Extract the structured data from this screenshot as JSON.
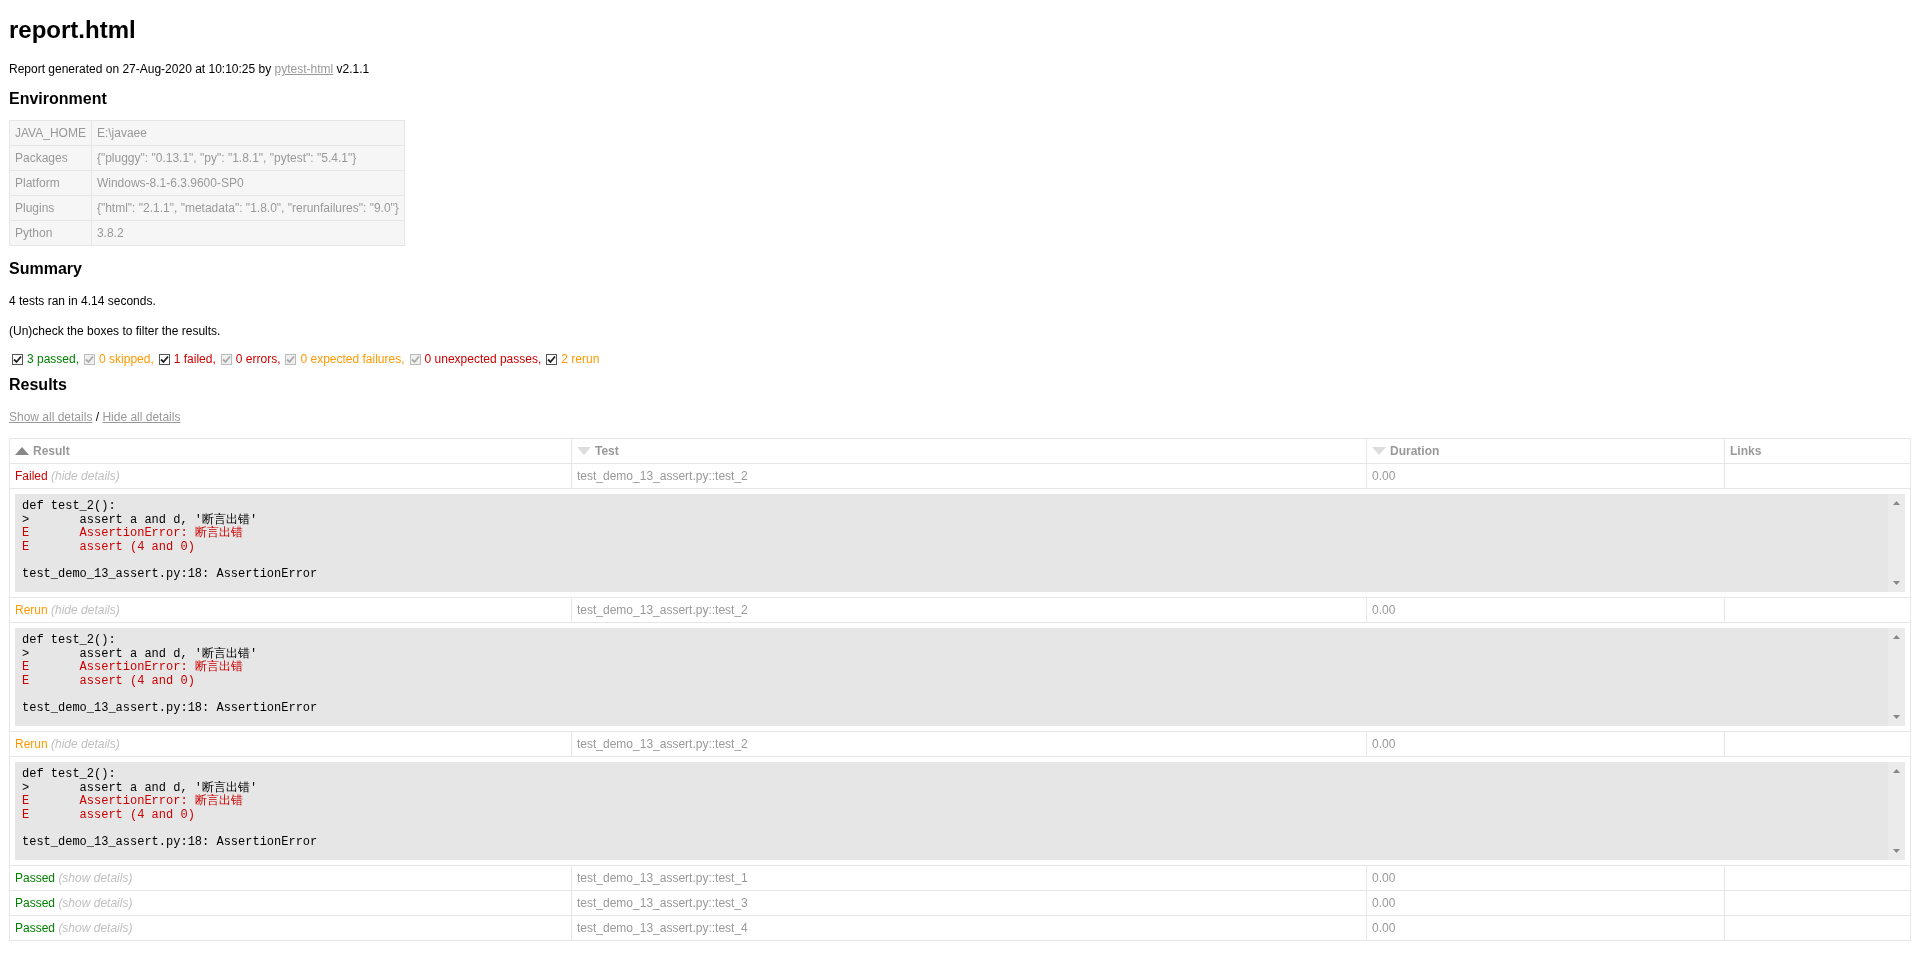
{
  "title": "report.html",
  "generated": {
    "prefix": "Report generated on 27-Aug-2020 at 10:10:25 by",
    "link": "pytest-html",
    "suffix": "v2.1.1"
  },
  "environment": {
    "heading": "Environment",
    "rows": [
      {
        "key": "JAVA_HOME",
        "value": "E:\\javaee"
      },
      {
        "key": "Packages",
        "value": "{\"pluggy\": \"0.13.1\", \"py\": \"1.8.1\", \"pytest\": \"5.4.1\"}"
      },
      {
        "key": "Platform",
        "value": "Windows-8.1-6.3.9600-SP0"
      },
      {
        "key": "Plugins",
        "value": "{\"html\": \"2.1.1\", \"metadata\": \"1.8.0\", \"rerunfailures\": \"9.0\"}"
      },
      {
        "key": "Python",
        "value": "3.8.2"
      }
    ]
  },
  "summary": {
    "heading": "Summary",
    "ran": "4 tests ran in 4.14 seconds.",
    "hint": "(Un)check the boxes to filter the results.",
    "filters": [
      {
        "label": "3 passed,",
        "color": "#008000",
        "checked": true,
        "disabled": false
      },
      {
        "label": "0 skipped,",
        "color": "#ff9900",
        "checked": true,
        "disabled": true
      },
      {
        "label": "1 failed,",
        "color": "#cc0000",
        "checked": true,
        "disabled": false
      },
      {
        "label": "0 errors,",
        "color": "#cc0000",
        "checked": true,
        "disabled": true
      },
      {
        "label": "0 expected failures,",
        "color": "#ff9900",
        "checked": true,
        "disabled": true
      },
      {
        "label": "0 unexpected passes,",
        "color": "#cc0000",
        "checked": true,
        "disabled": true
      },
      {
        "label": "2 rerun",
        "color": "#ff9900",
        "checked": true,
        "disabled": false
      }
    ]
  },
  "results": {
    "heading": "Results",
    "show_all": "Show all details",
    "separator": "/",
    "hide_all": "Hide all details",
    "columns": [
      {
        "label": "Result",
        "sorted": true
      },
      {
        "label": "Test",
        "sorted": false
      },
      {
        "label": "Duration",
        "sorted": false
      },
      {
        "label": "Links"
      }
    ],
    "rows": [
      {
        "result": "Failed",
        "kind": "failed",
        "toggle": "(hide details)",
        "test": "test_demo_13_assert.py::test_2",
        "duration": "0.00",
        "log": [
          {
            "kind": "code",
            "text": "def test_2():"
          },
          {
            "kind": "code",
            "text": ">       assert a and d, '断言出错'"
          },
          {
            "kind": "error",
            "text": "E       AssertionError: 断言出错"
          },
          {
            "kind": "error",
            "text": "E       assert (4 and 0)"
          },
          {
            "kind": "blank"
          },
          {
            "kind": "code",
            "text": "test_demo_13_assert.py:18: AssertionError"
          }
        ]
      },
      {
        "result": "Rerun",
        "kind": "rerun",
        "toggle": "(hide details)",
        "test": "test_demo_13_assert.py::test_2",
        "duration": "0.00",
        "log": [
          {
            "kind": "code",
            "text": "def test_2():"
          },
          {
            "kind": "code",
            "text": ">       assert a and d, '断言出错'"
          },
          {
            "kind": "error",
            "text": "E       AssertionError: 断言出错"
          },
          {
            "kind": "error",
            "text": "E       assert (4 and 0)"
          },
          {
            "kind": "blank"
          },
          {
            "kind": "code",
            "text": "test_demo_13_assert.py:18: AssertionError"
          }
        ]
      },
      {
        "result": "Rerun",
        "kind": "rerun",
        "toggle": "(hide details)",
        "test": "test_demo_13_assert.py::test_2",
        "duration": "0.00",
        "log": [
          {
            "kind": "code",
            "text": "def test_2():"
          },
          {
            "kind": "code",
            "text": ">       assert a and d, '断言出错'"
          },
          {
            "kind": "error",
            "text": "E       AssertionError: 断言出错"
          },
          {
            "kind": "error",
            "text": "E       assert (4 and 0)"
          },
          {
            "kind": "blank"
          },
          {
            "kind": "code",
            "text": "test_demo_13_assert.py:18: AssertionError"
          }
        ]
      },
      {
        "result": "Passed",
        "kind": "passed",
        "toggle": "(show details)",
        "test": "test_demo_13_assert.py::test_1",
        "duration": "0.00"
      },
      {
        "result": "Passed",
        "kind": "passed",
        "toggle": "(show details)",
        "test": "test_demo_13_assert.py::test_3",
        "duration": "0.00"
      },
      {
        "result": "Passed",
        "kind": "passed",
        "toggle": "(show details)",
        "test": "test_demo_13_assert.py::test_4",
        "duration": "0.00"
      }
    ]
  }
}
